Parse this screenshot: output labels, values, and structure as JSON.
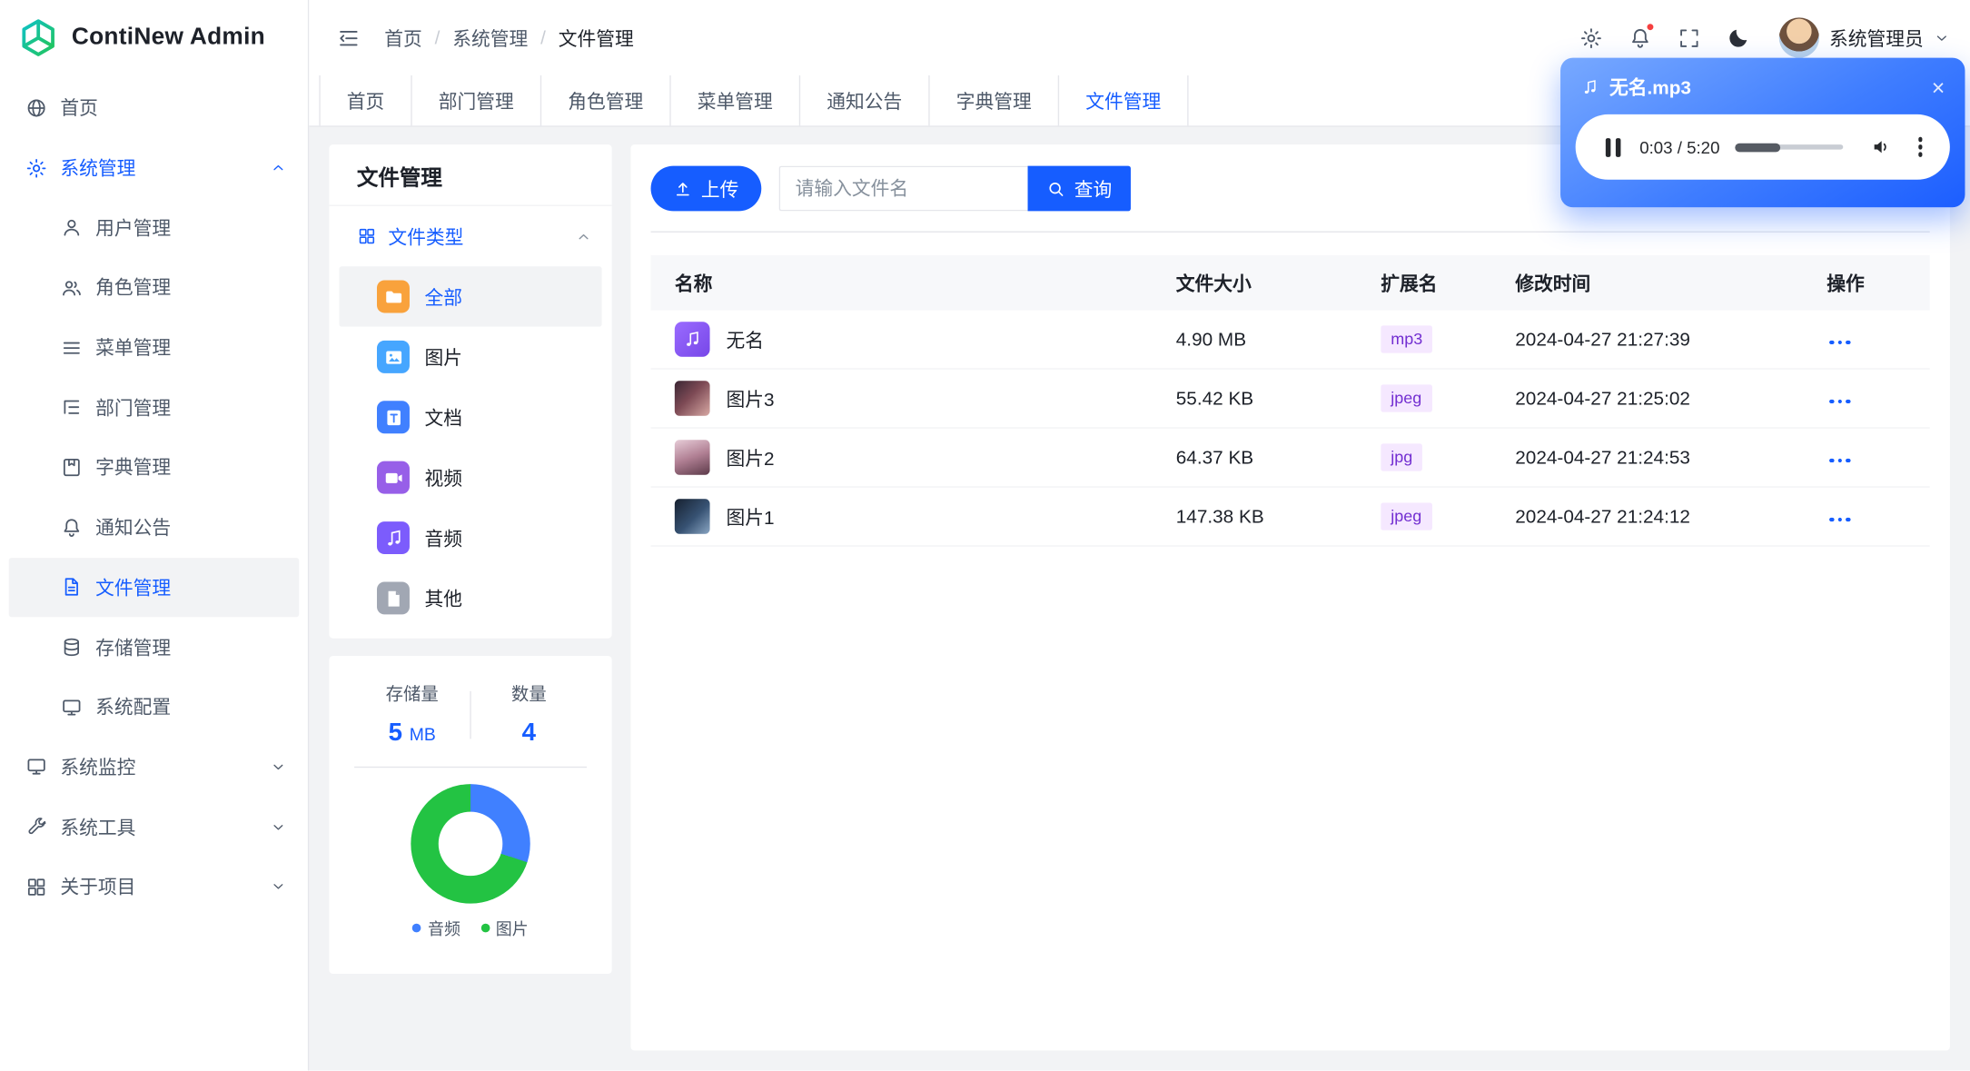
{
  "app": {
    "name": "ContiNew Admin"
  },
  "header": {
    "breadcrumb": {
      "items": [
        "首页",
        "系统管理",
        "文件管理"
      ],
      "separator": "/"
    },
    "user_name": "系统管理员"
  },
  "sidebar": {
    "home": "首页",
    "system_management": "系统管理",
    "system_children": [
      "用户管理",
      "角色管理",
      "菜单管理",
      "部门管理",
      "字典管理",
      "通知公告",
      "文件管理",
      "存储管理",
      "系统配置"
    ],
    "active_item": "文件管理",
    "system_monitor": "系统监控",
    "system_tools": "系统工具",
    "about_project": "关于项目"
  },
  "tabbar": {
    "tabs": [
      "首页",
      "部门管理",
      "角色管理",
      "菜单管理",
      "通知公告",
      "字典管理",
      "文件管理"
    ],
    "active": "文件管理"
  },
  "filter_panel": {
    "title": "文件管理",
    "tree_root": "文件类型",
    "types": [
      "全部",
      "图片",
      "文档",
      "视频",
      "音频",
      "其他"
    ],
    "selected": "全部"
  },
  "stats_panel": {
    "storage_label": "存储量",
    "storage_value": "5",
    "storage_unit": "MB",
    "count_label": "数量",
    "count_value": "4"
  },
  "chart_data": {
    "type": "pie",
    "labels": [
      "音频",
      "图片"
    ],
    "values_percent": [
      30,
      70
    ],
    "counts": [
      1,
      3
    ],
    "colors": [
      "#4080FF",
      "#23C343"
    ],
    "legend_position": "bottom",
    "donut": true
  },
  "toolbar": {
    "upload_label": "上传",
    "search_placeholder": "请输入文件名",
    "query_label": "查询"
  },
  "file_table": {
    "headers": {
      "name": "名称",
      "size": "文件大小",
      "ext": "扩展名",
      "modified": "修改时间",
      "actions": "操作"
    },
    "rows": [
      {
        "name": "无名",
        "size": "4.90 MB",
        "ext": "mp3",
        "modified": "2024-04-27 21:27:39"
      },
      {
        "name": "图片3",
        "size": "55.42 KB",
        "ext": "jpeg",
        "modified": "2024-04-27 21:25:02"
      },
      {
        "name": "图片2",
        "size": "64.37 KB",
        "ext": "jpg",
        "modified": "2024-04-27 21:24:53"
      },
      {
        "name": "图片1",
        "size": "147.38 KB",
        "ext": "jpeg",
        "modified": "2024-04-27 21:24:12"
      }
    ]
  },
  "audio_player": {
    "title": "无名.mp3",
    "time": "0:03 / 5:20"
  },
  "colors": {
    "primary": "#165DFF",
    "badge_bg": "#F5E8FF",
    "badge_text": "#722ED1"
  }
}
